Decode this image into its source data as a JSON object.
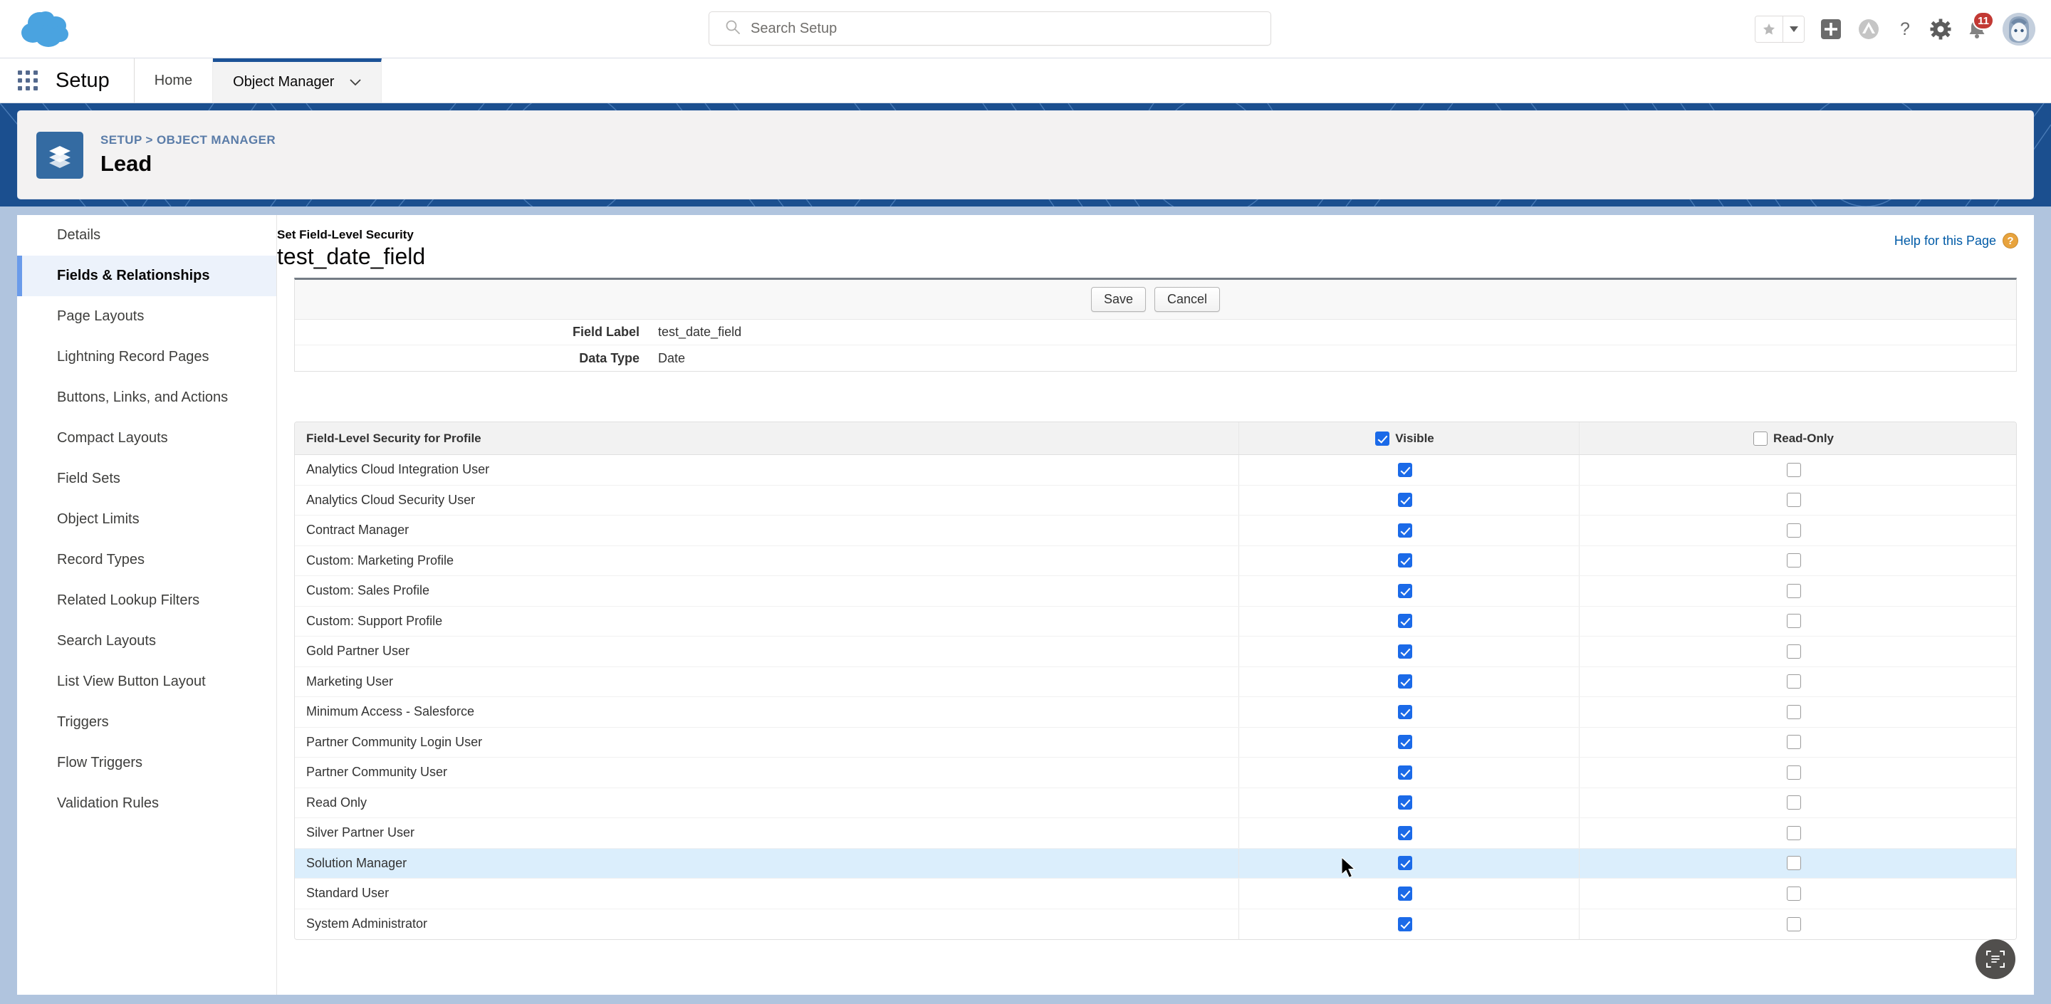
{
  "global_header": {
    "logo": "salesforce-cloud-logo",
    "search": {
      "placeholder": "Search Setup",
      "value": "",
      "icon": "search-icon"
    },
    "icons": [
      {
        "name": "favorites-star-icon",
        "glyph": "★"
      },
      {
        "name": "favorites-dropdown-icon",
        "glyph": "▾"
      },
      {
        "name": "global-actions-plus-icon",
        "glyph": "+"
      },
      {
        "name": "trailhead-icon",
        "glyph": "⛰"
      },
      {
        "name": "help-question-icon",
        "glyph": "?"
      },
      {
        "name": "setup-gear-icon",
        "glyph": "⚙"
      },
      {
        "name": "notifications-bell-icon",
        "glyph": "🔔"
      },
      {
        "name": "user-avatar",
        "glyph": ""
      }
    ],
    "notification_count": "11"
  },
  "setup_bar": {
    "app_launcher": "app-launcher-waffle-icon",
    "title": "Setup",
    "tabs": [
      {
        "label": "Home",
        "active": false,
        "has_caret": false
      },
      {
        "label": "Object Manager",
        "active": true,
        "has_caret": true
      }
    ]
  },
  "page_header": {
    "object_icon": "layers-icon",
    "breadcrumb": {
      "root": "SETUP",
      "separator": ">",
      "parent": "OBJECT MANAGER"
    },
    "title": "Lead"
  },
  "sidebar": {
    "items": [
      {
        "label": "Details",
        "active": false
      },
      {
        "label": "Fields & Relationships",
        "active": true
      },
      {
        "label": "Page Layouts",
        "active": false
      },
      {
        "label": "Lightning Record Pages",
        "active": false
      },
      {
        "label": "Buttons, Links, and Actions",
        "active": false
      },
      {
        "label": "Compact Layouts",
        "active": false
      },
      {
        "label": "Field Sets",
        "active": false
      },
      {
        "label": "Object Limits",
        "active": false
      },
      {
        "label": "Record Types",
        "active": false
      },
      {
        "label": "Related Lookup Filters",
        "active": false
      },
      {
        "label": "Search Layouts",
        "active": false
      },
      {
        "label": "List View Button Layout",
        "active": false
      },
      {
        "label": "Triggers",
        "active": false
      },
      {
        "label": "Flow Triggers",
        "active": false
      },
      {
        "label": "Validation Rules",
        "active": false
      }
    ]
  },
  "main": {
    "eyebrow": "Set Field-Level Security",
    "title": "test_date_field",
    "help_link": {
      "label": "Help for this Page",
      "icon": "help-question-icon",
      "glyph": "?"
    },
    "buttons": {
      "save": "Save",
      "cancel": "Cancel"
    },
    "info_rows": [
      {
        "label": "Field Label",
        "value": "test_date_field"
      },
      {
        "label": "Data Type",
        "value": "Date"
      }
    ],
    "table": {
      "headers": {
        "profile": "Field-Level Security for Profile",
        "visible": "Visible",
        "readonly": "Read-Only"
      },
      "header_checkboxes": {
        "visible": true,
        "readonly": false
      },
      "rows": [
        {
          "profile": "Analytics Cloud Integration User",
          "visible": true,
          "readonly": false,
          "hover": false
        },
        {
          "profile": "Analytics Cloud Security User",
          "visible": true,
          "readonly": false,
          "hover": false
        },
        {
          "profile": "Contract Manager",
          "visible": true,
          "readonly": false,
          "hover": false
        },
        {
          "profile": "Custom: Marketing Profile",
          "visible": true,
          "readonly": false,
          "hover": false
        },
        {
          "profile": "Custom: Sales Profile",
          "visible": true,
          "readonly": false,
          "hover": false
        },
        {
          "profile": "Custom: Support Profile",
          "visible": true,
          "readonly": false,
          "hover": false
        },
        {
          "profile": "Gold Partner User",
          "visible": true,
          "readonly": false,
          "hover": false
        },
        {
          "profile": "Marketing User",
          "visible": true,
          "readonly": false,
          "hover": false
        },
        {
          "profile": "Minimum Access - Salesforce",
          "visible": true,
          "readonly": false,
          "hover": false
        },
        {
          "profile": "Partner Community Login User",
          "visible": true,
          "readonly": false,
          "hover": false
        },
        {
          "profile": "Partner Community User",
          "visible": true,
          "readonly": false,
          "hover": false
        },
        {
          "profile": "Read Only",
          "visible": true,
          "readonly": false,
          "hover": false
        },
        {
          "profile": "Silver Partner User",
          "visible": true,
          "readonly": false,
          "hover": false
        },
        {
          "profile": "Solution Manager",
          "visible": true,
          "readonly": false,
          "hover": true
        },
        {
          "profile": "Standard User",
          "visible": true,
          "readonly": false,
          "hover": false
        },
        {
          "profile": "System Administrator",
          "visible": true,
          "readonly": false,
          "hover": false
        }
      ]
    }
  },
  "fab": {
    "name": "einstein-scan-button",
    "icon": "document-scan-icon"
  },
  "colors": {
    "brand_blue": "#1b5297",
    "banner_blue": "#1b4f8f",
    "checkbox_blue": "#1b6ae8",
    "hover_row": "#dbeefc",
    "badge_red": "#c23934",
    "link_blue": "#015ba7"
  }
}
